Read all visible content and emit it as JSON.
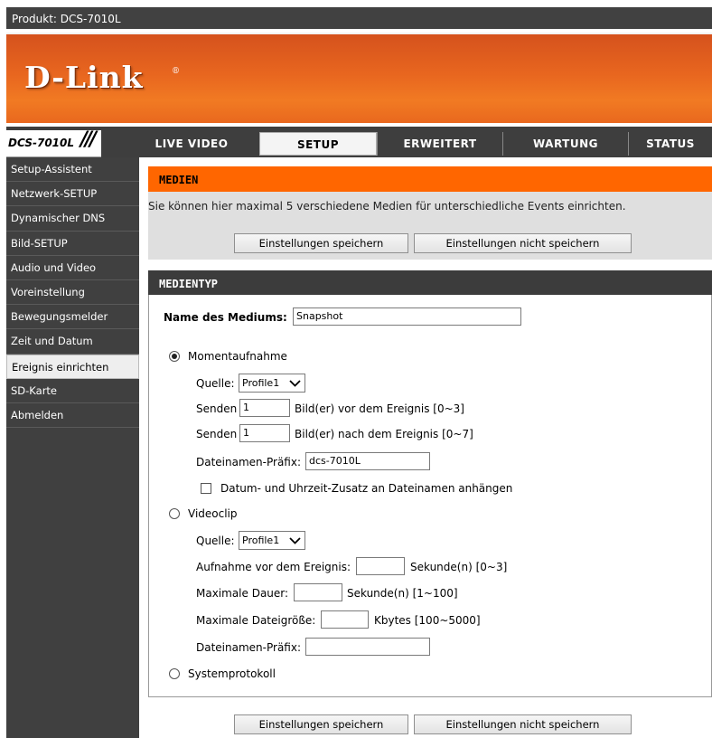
{
  "topbar": {
    "product_label": "Produkt: DCS-7010L"
  },
  "brand": {
    "logo_text": "D-Link",
    "reg_mark": "®"
  },
  "nav": {
    "model": "DCS-7010L",
    "slashes": "///",
    "tabs": [
      {
        "label": "LIVE VIDEO"
      },
      {
        "label": "SETUP"
      },
      {
        "label": "ERWEITERT"
      },
      {
        "label": "WARTUNG"
      },
      {
        "label": "STATUS"
      }
    ]
  },
  "sidebar": {
    "items": [
      {
        "label": "Setup-Assistent"
      },
      {
        "label": "Netzwerk-SETUP"
      },
      {
        "label": "Dynamischer DNS"
      },
      {
        "label": "Bild-SETUP"
      },
      {
        "label": "Audio und Video"
      },
      {
        "label": "Voreinstellung"
      },
      {
        "label": "Bewegungsmelder"
      },
      {
        "label": "Zeit und Datum"
      },
      {
        "label": "Ereignis einrichten"
      },
      {
        "label": "SD-Karte"
      },
      {
        "label": "Abmelden"
      }
    ]
  },
  "medien": {
    "title": "MEDIEN",
    "description": "Sie können hier maximal 5 verschiedene Medien für unterschiedliche Events einrichten.",
    "save_label": "Einstellungen speichern",
    "dont_save_label": "Einstellungen nicht speichern"
  },
  "medientyp": {
    "title": "MEDIENTYP",
    "name_label": "Name des Mediums:",
    "name_value": "Snapshot",
    "snapshot": {
      "label": "Momentaufnahme",
      "selected": true,
      "source_label": "Quelle:",
      "source_value": "Profile1",
      "send_label": "Senden",
      "pre_value": "1",
      "pre_suffix": "Bild(er) vor dem Ereignis [0~3]",
      "post_value": "1",
      "post_suffix": "Bild(er) nach dem Ereignis [0~7]",
      "prefix_label": "Dateinamen-Präfix:",
      "prefix_value": "dcs-7010L",
      "suffix_checkbox_label": "Datum- und Uhrzeit-Zusatz an Dateinamen anhängen",
      "suffix_checked": false
    },
    "videoclip": {
      "label": "Videoclip",
      "selected": false,
      "source_label": "Quelle:",
      "source_value": "Profile1",
      "pre_event_label": "Aufnahme vor dem Ereignis:",
      "pre_event_value": "",
      "pre_event_suffix": "Sekunde(n) [0~3]",
      "max_duration_label": "Maximale Dauer:",
      "max_duration_value": "",
      "max_duration_suffix": "Sekunde(n) [1~100]",
      "max_size_label": "Maximale Dateigröße:",
      "max_size_value": "",
      "max_size_suffix": "Kbytes [100~5000]",
      "prefix_label": "Dateinamen-Präfix:",
      "prefix_value": ""
    },
    "systemlog": {
      "label": "Systemprotokoll",
      "selected": false
    }
  },
  "footer": {
    "save_label": "Einstellungen speichern",
    "dont_save_label": "Einstellungen nicht speichern"
  },
  "colors": {
    "orange": "#ff6600",
    "dark": "#404040",
    "panel_gray": "#dfdfdf"
  }
}
